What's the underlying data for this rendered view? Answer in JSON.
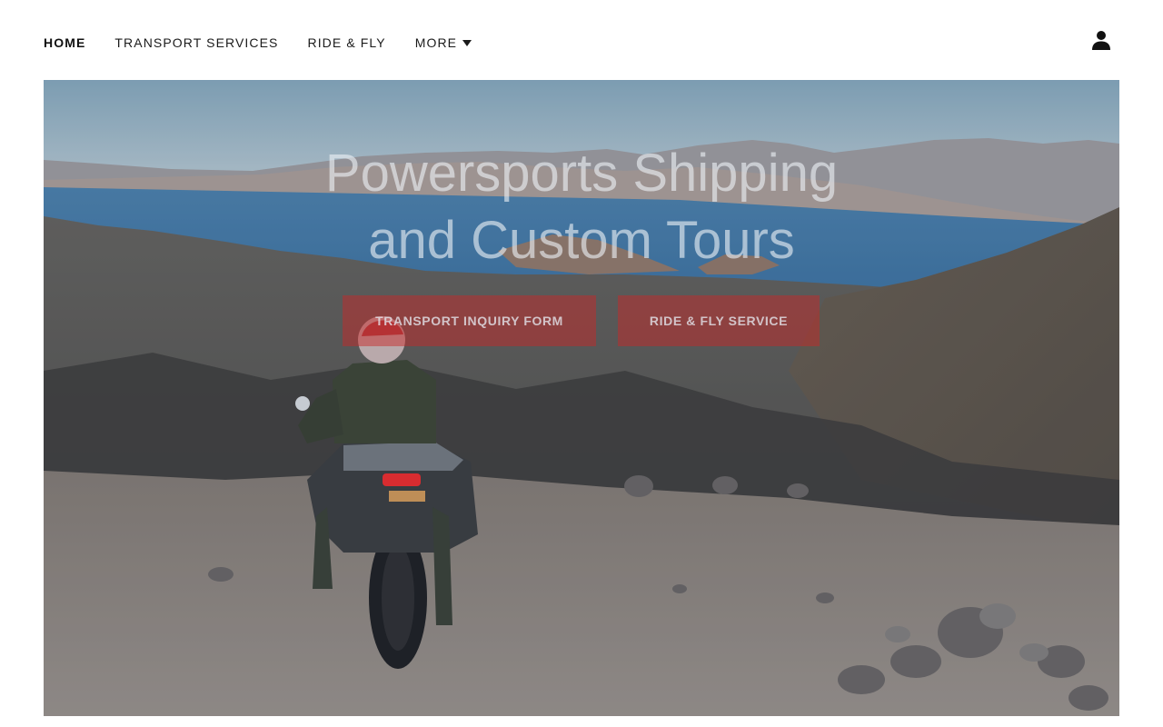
{
  "nav": {
    "items": [
      {
        "label": "HOME",
        "active": true
      },
      {
        "label": "TRANSPORT SERVICES",
        "active": false
      },
      {
        "label": "RIDE & FLY",
        "active": false
      }
    ],
    "more_label": "MORE",
    "more_icon": "caret-down-icon",
    "account_icon": "person-icon"
  },
  "hero": {
    "title_line1": "Powersports Shipping",
    "title_line2": "and Custom Tours",
    "buttons": [
      {
        "label": "TRANSPORT INQUIRY FORM"
      },
      {
        "label": "RIDE & FLY SERVICE"
      }
    ],
    "button_color": "#c82828"
  }
}
